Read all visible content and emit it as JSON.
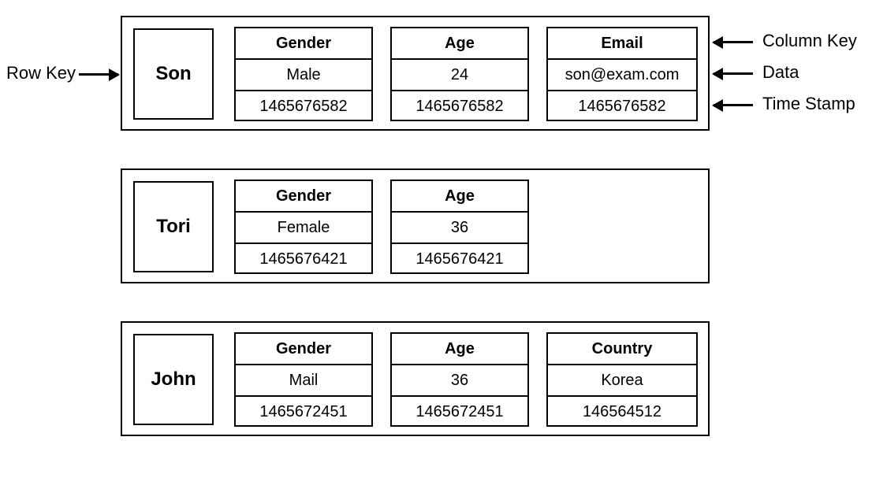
{
  "annotations": {
    "row_key": "Row Key",
    "column_key": "Column Key",
    "data": "Data",
    "time_stamp": "Time Stamp"
  },
  "rows": [
    {
      "key": "Son",
      "columns": [
        {
          "name": "Gender",
          "value": "Male",
          "timestamp": "1465676582"
        },
        {
          "name": "Age",
          "value": "24",
          "timestamp": "1465676582"
        },
        {
          "name": "Email",
          "value": "son@exam.com",
          "timestamp": "1465676582"
        }
      ]
    },
    {
      "key": "Tori",
      "columns": [
        {
          "name": "Gender",
          "value": "Female",
          "timestamp": "1465676421"
        },
        {
          "name": "Age",
          "value": "36",
          "timestamp": "1465676421"
        }
      ]
    },
    {
      "key": "John",
      "columns": [
        {
          "name": "Gender",
          "value": "Mail",
          "timestamp": "1465672451"
        },
        {
          "name": "Age",
          "value": "36",
          "timestamp": "1465672451"
        },
        {
          "name": "Country",
          "value": "Korea",
          "timestamp": "146564512"
        }
      ]
    }
  ]
}
